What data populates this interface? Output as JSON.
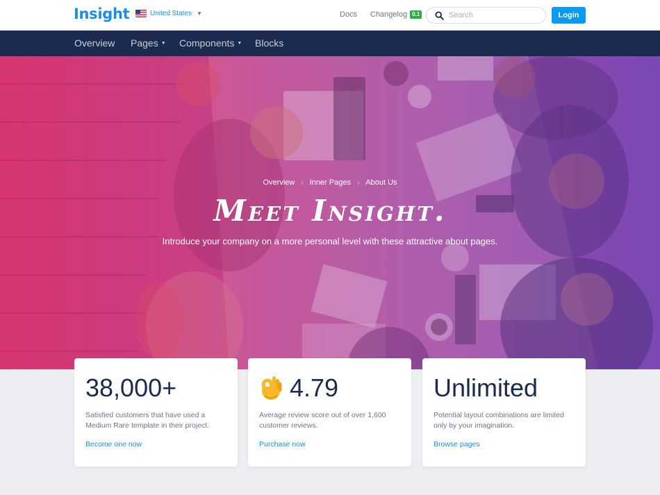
{
  "header": {
    "logo": "Insight",
    "country": "United States",
    "docs": "Docs",
    "changelog": "Changelog",
    "changelog_badge": "0.1",
    "search_placeholder": "Search",
    "login": "Login"
  },
  "nav": {
    "items": [
      {
        "label": "Overview"
      },
      {
        "label": "Pages"
      },
      {
        "label": "Components"
      },
      {
        "label": "Blocks"
      }
    ]
  },
  "hero": {
    "breadcrumb": [
      "Overview",
      "Inner Pages",
      "About Us"
    ],
    "title": "Meet Insight.",
    "subtitle": "Introduce your company on a more personal level with these attractive about pages.",
    "gradient_start": "#d7356f",
    "gradient_end": "#7b48b4"
  },
  "stats": [
    {
      "value": "38,000+",
      "description": "Satisfied customers that have used a Medium Rare template in their project.",
      "link": "Become one now"
    },
    {
      "icon": "ok-hand-icon",
      "value": "4.79",
      "description": "Average review score out of over 1,600 customer reviews.",
      "link": "Purchase now"
    },
    {
      "value": "Unlimited",
      "description": "Potential layout combinations are limited only by your imagination.",
      "link": "Browse pages"
    }
  ],
  "colors": {
    "brand": "#1a8ee6",
    "navbar": "#1b2a4e",
    "login_button": "#0a9bf0",
    "badge": "#28b246"
  }
}
